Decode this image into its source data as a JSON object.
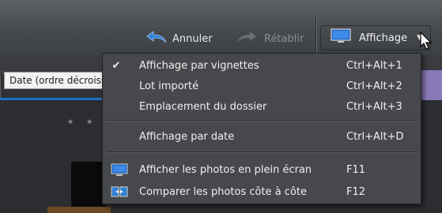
{
  "toolbar": {
    "undo_label": "Annuler",
    "redo_label": "Rétablir",
    "view_label": "Affichage"
  },
  "sort": {
    "value": "Date (ordre décroissant)"
  },
  "menu": {
    "items": [
      {
        "label": "Affichage par vignettes",
        "shortcut": "Ctrl+Alt+1",
        "checked": true
      },
      {
        "label": "Lot importé",
        "shortcut": "Ctrl+Alt+2"
      },
      {
        "label": "Emplacement du dossier",
        "shortcut": "Ctrl+Alt+3"
      },
      {
        "label": "Affichage par date",
        "shortcut": "Ctrl+Alt+D"
      },
      {
        "label": "Afficher les photos en plein écran",
        "shortcut": "F11",
        "icon": "monitor-icon"
      },
      {
        "label": "Comparer les photos côte à côte",
        "shortcut": "F12",
        "icon": "compare-icon"
      }
    ]
  },
  "colors": {
    "accent_blue": "#1f6fc3",
    "menu_bg": "#46484b",
    "toolbar_bg": "#4f5256"
  }
}
